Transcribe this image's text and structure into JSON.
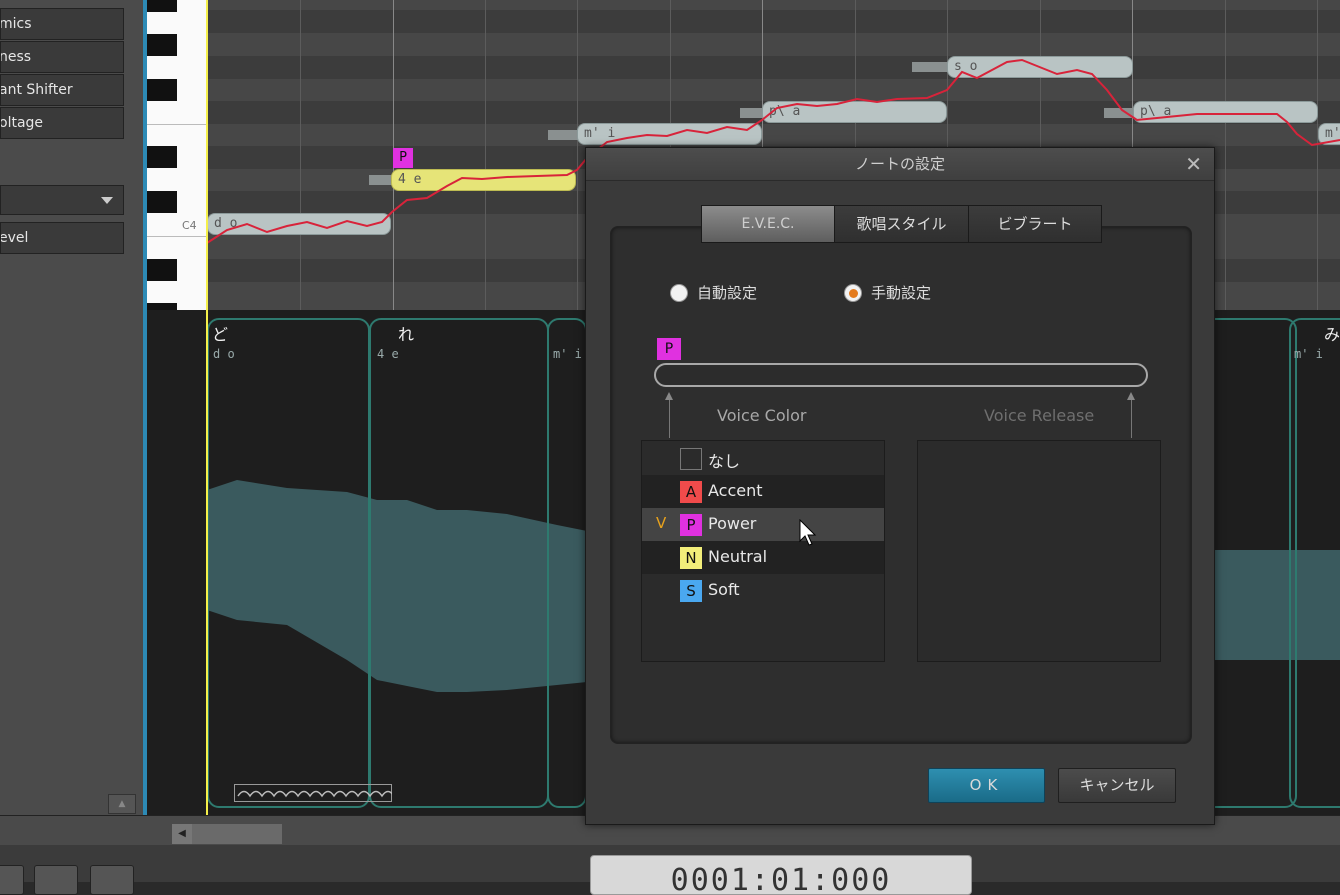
{
  "left_panel": {
    "items": [
      "mics",
      "ness",
      "ant Shifter",
      "oltage",
      "evel"
    ]
  },
  "piano_roll": {
    "c4_label": "C4",
    "power_tag": "P",
    "notes": [
      "d o",
      "4 e",
      "m' i",
      "p\\ a",
      "s o",
      "p\\ a",
      "m' "
    ]
  },
  "lyric_segments": [
    {
      "kana": "ど",
      "phoneme": "d o"
    },
    {
      "kana": "れ",
      "phoneme": "4 e"
    },
    {
      "kana": "",
      "phoneme": "m' i"
    },
    {
      "kana": "み",
      "phoneme": "m' i"
    }
  ],
  "dialog": {
    "title": "ノートの設定",
    "close_glyph": "✕",
    "tabs": [
      "E.V.E.C.",
      "歌唱スタイル",
      "ビブラート"
    ],
    "active_tab": "E.V.E.C.",
    "radio_auto": "自動設定",
    "radio_manual": "手動設定",
    "selected_radio": "手動設定",
    "slider_tag": "P",
    "voice_color_label": "Voice Color",
    "voice_release_label": "Voice Release",
    "voice_color_items": [
      {
        "check": "",
        "badge": "",
        "badge_color": "",
        "label": "なし"
      },
      {
        "check": "",
        "badge": "A",
        "badge_color": "#f04b4b",
        "label": "Accent"
      },
      {
        "check": "V",
        "badge": "P",
        "badge_color": "#e031e0",
        "label": "Power"
      },
      {
        "check": "",
        "badge": "N",
        "badge_color": "#f2ee7a",
        "label": "Neutral"
      },
      {
        "check": "",
        "badge": "S",
        "badge_color": "#4aa8f0",
        "label": "Soft"
      }
    ],
    "ok_label": "OK",
    "cancel_label": "キャンセル"
  },
  "transport": {
    "timecode": "0001:01:000"
  },
  "colors": {
    "accent_blue": "#2d8ab5",
    "pitch_line": "#d8233a",
    "playhead": "#f5f04a",
    "power": "#e031e0"
  }
}
